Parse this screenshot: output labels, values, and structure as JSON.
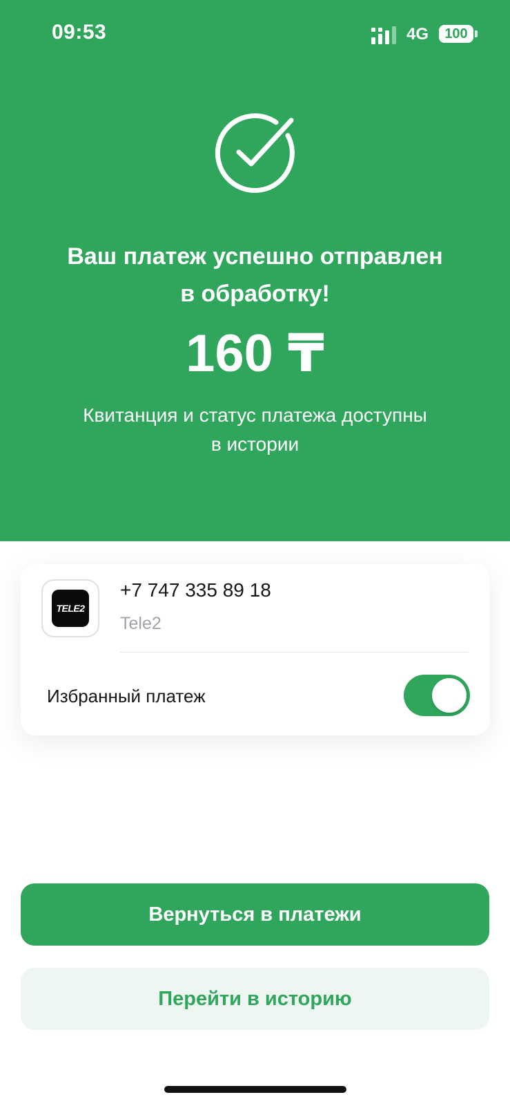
{
  "status_bar": {
    "time": "09:53",
    "network": "4G",
    "battery": "100"
  },
  "result": {
    "title_line1": "Ваш платеж успешно отправлен",
    "title_line2": "в обработку!",
    "amount": "160 ₸",
    "subtitle_line1": "Квитанция и статус платежа доступны",
    "subtitle_line2": "в истории"
  },
  "payment": {
    "phone": "+7 747 335 89 18",
    "operator": "Tele2",
    "logo_text": "TELE2",
    "favorite_label": "Избранный платеж",
    "favorite_enabled": true
  },
  "actions": {
    "back_label": "Вернуться в платежи",
    "history_label": "Перейти в историю"
  },
  "colors": {
    "accent": "#2fa65c",
    "secondary_bg": "#eef6f1"
  }
}
